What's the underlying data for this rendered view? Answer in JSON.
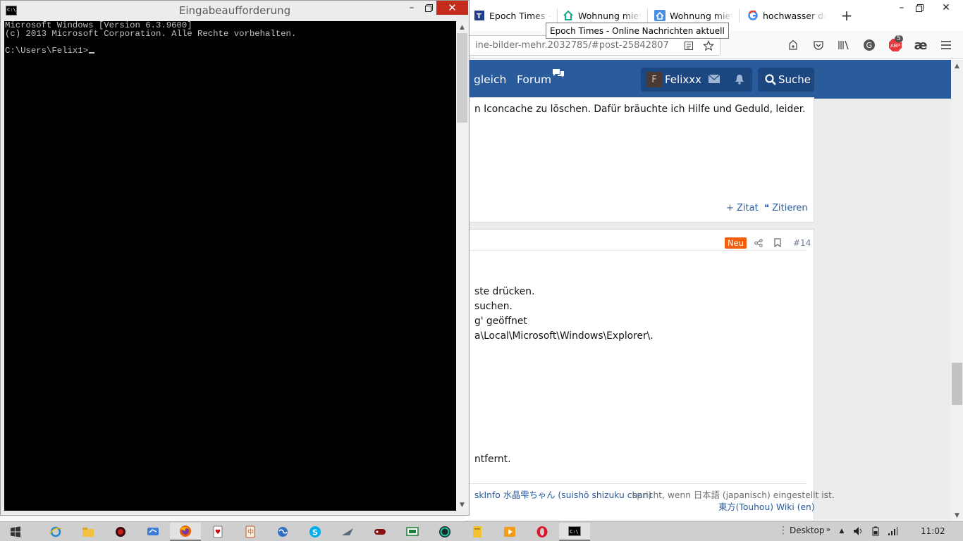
{
  "firefox": {
    "tabs": [
      {
        "label": "Epoch Times - O",
        "icon": "epoch-times-favicon"
      },
      {
        "label": "Wohnung miete",
        "icon": "house-favicon"
      },
      {
        "label": "Wohnung miete",
        "icon": "house-favicon"
      },
      {
        "label": "hochwasser deut",
        "icon": "google-favicon"
      }
    ],
    "new_tab_label": "+",
    "tooltip": "Epoch Times - Online Nachrichten aktuell",
    "url": "ine-bilder-mehr.2032785/#post-25842807",
    "adblock_badge": "5"
  },
  "forum": {
    "nav": {
      "vergleich": "gleich",
      "forum": "Forum"
    },
    "user": {
      "avatar_letter": "F",
      "name": "Felixxx"
    },
    "search_label": "Suche",
    "post1": {
      "text": "n Iconcache zu löschen. Dafür bräuchte ich Hilfe und Geduld, leider.",
      "action_zitat": "Zitat",
      "action_zitieren": "Zitieren"
    },
    "post2": {
      "badge": "Neu",
      "number": "#14",
      "lines": [
        "ste drücken.",
        "suchen.",
        "g' geöffnet",
        "a\\Local\\Microsoft\\Windows\\Explorer\\."
      ],
      "line_entfernt": "ntfernt.",
      "sig_link1": "skInfo 水晶雫ちゃん (suishō shizuku chan)",
      "sig_text": " spricht, wenn 日本語 (japanisch) eingestellt ist.",
      "sig_link2": "東方(Touhou) Wiki (en)"
    }
  },
  "cmd": {
    "title": "Eingabeaufforderung",
    "lines": [
      "Microsoft Windows [Version 6.3.9600]",
      "(c) 2013 Microsoft Corporation. Alle Rechte vorbehalten.",
      "",
      "C:\\Users\\Felix1>"
    ]
  },
  "taskbar": {
    "items": [
      "start",
      "internet-explorer",
      "file-explorer",
      "app-red",
      "app-remote",
      "firefox",
      "solitaire",
      "app-mahjong",
      "app-globe",
      "skype",
      "app-ray",
      "app-game",
      "app-screen",
      "app-teal",
      "app-files",
      "app-media",
      "opera",
      "command-prompt"
    ],
    "desktop_label": "Desktop",
    "time": "11:02"
  },
  "colors": {
    "forum_header": "#2a5c9c",
    "neu_badge": "#f06010",
    "cmd_close": "#c42b1c",
    "link": "#2a5c9c"
  }
}
